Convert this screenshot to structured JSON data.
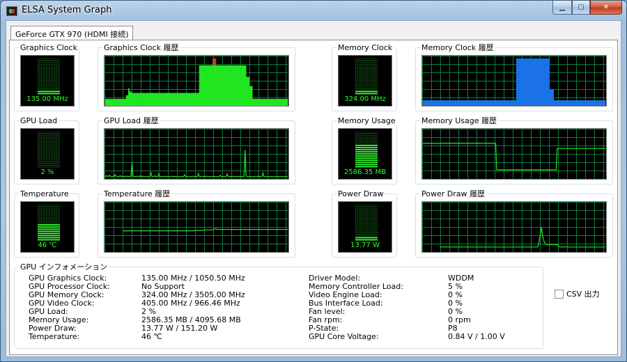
{
  "window": {
    "title": "ELSA System Graph",
    "min_glyph": "▁",
    "max_glyph": "▢",
    "close_glyph": "✕"
  },
  "tabs": [
    {
      "label": "GeForce GTX 970 (HDMI 接続)",
      "selected": true
    }
  ],
  "monitors": {
    "graphics_clock": {
      "label": "Graphics Clock",
      "value": "135.00 MHz",
      "level": 0.1,
      "history_label": "Graphics Clock 履歴",
      "color": "#21e621"
    },
    "memory_clock": {
      "label": "Memory Clock",
      "value": "324.00 MHz",
      "level": 0.1,
      "history_label": "Memory Clock 履歴",
      "color": "#1a73e6"
    },
    "gpu_load": {
      "label": "GPU Load",
      "value": "2 %",
      "level": 0.02,
      "history_label": "GPU Load 履歴",
      "color": "#21e621"
    },
    "memory_usage": {
      "label": "Memory Usage",
      "value": "2586.35 MB",
      "level": 0.63,
      "history_label": "Memory Usage 履歴",
      "color": "#21e621"
    },
    "temperature": {
      "label": "Temperature",
      "value": "46 ℃",
      "level": 0.46,
      "history_label": "Temperature 履歴",
      "color": "#21e621"
    },
    "power_draw": {
      "label": "Power Draw",
      "value": "13.77 W",
      "level": 0.09,
      "history_label": "Power Draw 履歴",
      "color": "#21e621"
    }
  },
  "info": {
    "group_label": "GPU インフォメーション",
    "left": [
      {
        "key": "GPU Graphics Clock:",
        "value": "135.00 MHz / 1050.50 MHz"
      },
      {
        "key": "GPU Processor Clock:",
        "value": "No Support"
      },
      {
        "key": "GPU Memory Clock:",
        "value": "324.00 MHz / 3505.00 MHz"
      },
      {
        "key": "GPU Video Clock:",
        "value": "405.00 MHz / 966.46 MHz"
      },
      {
        "key": "GPU Load:",
        "value": "2 %"
      },
      {
        "key": "Memory Usage:",
        "value": "2586.35 MB / 4095.68 MB"
      },
      {
        "key": "Power Draw:",
        "value": "13.77 W / 151.20 W"
      },
      {
        "key": "Temperature:",
        "value": "46 ℃"
      }
    ],
    "right": [
      {
        "key": "Driver Model:",
        "value": "WDDM"
      },
      {
        "key": "Memory Controller Load:",
        "value": "5 %"
      },
      {
        "key": "Video Engine Load:",
        "value": "0 %"
      },
      {
        "key": "Bus Interface Load:",
        "value": "0 %"
      },
      {
        "key": "Fan level:",
        "value": "0 %"
      },
      {
        "key": "Fan rpm:",
        "value": "0 rpm"
      },
      {
        "key": "P-State:",
        "value": "P8"
      },
      {
        "key": "GPU Core Voltage:",
        "value": "0.84 V / 1.00 V"
      }
    ]
  },
  "csv": {
    "label": "CSV 出力",
    "checked": false
  },
  "chart_data": [
    {
      "id": "graphics_clock_history",
      "type": "area",
      "title": "Graphics Clock 履歴",
      "color": "#21e621",
      "peak_color": "#c03c1c",
      "ylim": [
        0,
        1
      ],
      "values": [
        0.12,
        0.12,
        0.12,
        0.12,
        0.12,
        0.12,
        0.12,
        0.12,
        0.12,
        0.12,
        0.12,
        0.12,
        0.12,
        0.12,
        0.12,
        0.12,
        0.12,
        0.12,
        0.12,
        0.12,
        0.2,
        0.2,
        0.35,
        0.28,
        0.28,
        0.25,
        0.25,
        0.25,
        0.25,
        0.25,
        0.25,
        0.25,
        0.25,
        0.25,
        0.25,
        0.25,
        0.25,
        0.25,
        0.25,
        0.25,
        0.25,
        0.25,
        0.25,
        0.25,
        0.25,
        0.25,
        0.25,
        0.25,
        0.25,
        0.25,
        0.25,
        0.25,
        0.25,
        0.25,
        0.25,
        0.25,
        0.25,
        0.25,
        0.25,
        0.25,
        0.25,
        0.25,
        0.25,
        0.25,
        0.25,
        0.25,
        0.25,
        0.25,
        0.25,
        0.25,
        0.25,
        0.25,
        0.25,
        0.25,
        0.25,
        0.25,
        0.25,
        0.25,
        0.25,
        0.25,
        0.25,
        0.25,
        0.25,
        0.25,
        0.25,
        0.25,
        0.25,
        0.25,
        0.25,
        0.25,
        0.85,
        0.85,
        0.85,
        0.85,
        0.85,
        0.85,
        0.85,
        0.85,
        0.85,
        0.85,
        0.85,
        0.85,
        0.85,
        1.0,
        1.0,
        1.0,
        0.85,
        0.85,
        0.85,
        0.85,
        0.85,
        0.85,
        0.85,
        0.85,
        0.85,
        0.85,
        0.85,
        0.85,
        0.85,
        0.85,
        0.85,
        0.85,
        0.85,
        0.85,
        0.85,
        0.85,
        0.85,
        0.85,
        0.85,
        0.85,
        0.85,
        0.85,
        0.85,
        0.85,
        0.85,
        0.6,
        0.6,
        0.6,
        0.4,
        0.4,
        0.4,
        0.12,
        0.12,
        0.12,
        0.12,
        0.12,
        0.12,
        0.12,
        0.12,
        0.12,
        0.12,
        0.12,
        0.12,
        0.12,
        0.12,
        0.12,
        0.12,
        0.12,
        0.12,
        0.12,
        0.12,
        0.12,
        0.12,
        0.12,
        0.12,
        0.12,
        0.12,
        0.12,
        0.12,
        0.12,
        0.12,
        0.12,
        0.12,
        0.12,
        0.12
      ]
    },
    {
      "id": "memory_clock_history",
      "type": "area",
      "title": "Memory Clock 履歴",
      "color": "#1a73e6",
      "ylim": [
        0,
        1
      ],
      "values": [
        0.09,
        0.09,
        0.09,
        0.09,
        0.09,
        0.09,
        0.09,
        0.09,
        0.09,
        0.09,
        0.09,
        0.09,
        0.09,
        0.09,
        0.09,
        0.09,
        0.09,
        0.09,
        0.09,
        0.09,
        0.09,
        0.09,
        0.09,
        0.09,
        0.09,
        0.09,
        0.09,
        0.09,
        0.09,
        0.09,
        0.09,
        0.09,
        0.09,
        0.09,
        0.09,
        0.09,
        0.09,
        0.09,
        0.09,
        0.09,
        0.09,
        0.09,
        0.09,
        0.09,
        0.09,
        0.09,
        0.09,
        0.09,
        0.09,
        0.09,
        0.09,
        0.09,
        0.09,
        0.09,
        0.09,
        0.09,
        0.09,
        0.09,
        0.09,
        0.09,
        0.09,
        0.09,
        0.09,
        0.09,
        0.09,
        0.09,
        0.09,
        0.09,
        0.09,
        0.09,
        0.09,
        0.09,
        0.09,
        0.09,
        0.09,
        0.09,
        0.09,
        0.09,
        0.09,
        0.09,
        0.09,
        0.09,
        0.09,
        0.09,
        0.09,
        0.09,
        0.09,
        0.09,
        0.09,
        0.09,
        1.0,
        1.0,
        1.0,
        1.0,
        1.0,
        1.0,
        1.0,
        1.0,
        1.0,
        1.0,
        1.0,
        1.0,
        1.0,
        1.0,
        1.0,
        1.0,
        1.0,
        1.0,
        1.0,
        1.0,
        1.0,
        1.0,
        1.0,
        1.0,
        1.0,
        1.0,
        1.0,
        1.0,
        1.0,
        1.0,
        1.0,
        1.0,
        0.32,
        0.32,
        0.32,
        0.32,
        0.09,
        0.09,
        0.09,
        0.09,
        0.09,
        0.09,
        0.09,
        0.09,
        0.09,
        0.09,
        0.09,
        0.09,
        0.09,
        0.09,
        0.09,
        0.09,
        0.09,
        0.09,
        0.09,
        0.09,
        0.09,
        0.09,
        0.09,
        0.09,
        0.09,
        0.09,
        0.09,
        0.09,
        0.09,
        0.09,
        0.09,
        0.09,
        0.09,
        0.09,
        0.09,
        0.09,
        0.09,
        0.09,
        0.09,
        0.09,
        0.09,
        0.09,
        0.09,
        0.09,
        0.09,
        0.09,
        0.09,
        0.09,
        0.09,
        0.09
      ]
    },
    {
      "id": "gpu_load_history",
      "type": "line",
      "title": "GPU Load 履歴",
      "color": "#21e621",
      "ylim": [
        0,
        100
      ],
      "values": [
        2,
        4,
        3,
        2,
        5,
        3,
        2,
        2,
        3,
        2,
        6,
        3,
        2,
        2,
        2,
        4,
        2,
        3,
        2,
        2,
        3,
        2,
        3,
        2,
        2,
        3,
        2,
        32,
        3,
        2,
        2,
        2,
        3,
        2,
        2,
        4,
        2,
        2,
        3,
        2,
        2,
        2,
        2,
        2,
        2,
        3,
        12,
        2,
        2,
        2,
        4,
        2,
        2,
        2,
        8,
        2,
        2,
        2,
        2,
        2,
        3,
        2,
        2,
        2,
        2,
        2,
        2,
        2,
        3,
        2,
        2,
        2,
        2,
        2,
        2,
        2,
        2,
        2,
        2,
        2,
        6,
        2,
        2,
        2,
        2,
        2,
        2,
        2,
        2,
        3,
        2,
        2,
        2,
        2,
        9,
        2,
        2,
        2,
        2,
        2,
        2,
        2,
        3,
        2,
        2,
        2,
        2,
        2,
        2,
        3,
        2,
        2,
        2,
        2,
        2,
        2,
        5,
        2,
        2,
        2,
        2,
        2,
        2,
        8,
        2,
        2,
        2,
        2,
        3,
        2,
        2,
        2,
        2,
        2,
        2,
        2,
        2,
        2,
        2,
        2,
        2,
        60,
        3,
        2,
        2,
        2,
        2,
        2,
        2,
        2,
        2,
        2,
        2,
        2,
        3,
        2,
        2,
        2,
        2,
        10,
        2,
        2,
        2,
        2,
        2,
        2,
        2,
        2,
        2,
        2,
        2,
        2,
        2,
        2,
        2,
        2,
        2,
        2,
        2,
        2,
        2,
        2,
        2,
        2,
        2
      ]
    },
    {
      "id": "memory_usage_history",
      "type": "line",
      "title": "Memory Usage 履歴",
      "color": "#21e621",
      "ylim": [
        0,
        4095.68
      ],
      "values": [
        3050,
        3050,
        3050,
        3050,
        3050,
        3050,
        3050,
        3050,
        3050,
        3050,
        3050,
        3050,
        3050,
        3050,
        3050,
        3050,
        3050,
        3050,
        3050,
        3050,
        3050,
        3050,
        3050,
        3050,
        3050,
        3050,
        3050,
        3050,
        3050,
        3050,
        3050,
        3050,
        3050,
        3050,
        3050,
        3050,
        3050,
        3050,
        3050,
        3050,
        3050,
        3050,
        3050,
        3050,
        3050,
        3050,
        3050,
        3050,
        3050,
        3050,
        3050,
        3050,
        3050,
        3050,
        3050,
        3050,
        3050,
        3050,
        3050,
        3050,
        3050,
        3050,
        3050,
        3050,
        3050,
        3050,
        3050,
        3050,
        3050,
        3050,
        3050,
        3050,
        680,
        680,
        680,
        680,
        680,
        680,
        680,
        680,
        680,
        680,
        680,
        680,
        680,
        680,
        680,
        680,
        680,
        680,
        680,
        680,
        680,
        680,
        680,
        680,
        680,
        680,
        680,
        680,
        680,
        680,
        680,
        680,
        680,
        680,
        680,
        680,
        680,
        680,
        680,
        680,
        680,
        680,
        680,
        680,
        680,
        680,
        680,
        680,
        680,
        680,
        680,
        680,
        680,
        680,
        680,
        680,
        680,
        680,
        680,
        2586.35,
        2586.35,
        2586.35,
        2586.35,
        2586.35,
        2586.35,
        2586.35,
        2586.35,
        2586.35,
        2586.35,
        2586.35,
        2586.35,
        2586.35,
        2586.35,
        2586.35,
        2586.35,
        2586.35,
        2586.35,
        2586.35,
        2586.35,
        2586.35,
        2586.35,
        2586.35,
        2586.35,
        2586.35,
        2586.35,
        2586.35,
        2586.35,
        2586.35,
        2586.35,
        2586.35,
        2586.35,
        2586.35,
        2586.35,
        2586.35,
        2586.35,
        2586.35,
        2586.35,
        2586.35,
        2586.35,
        2586.35,
        2586.35,
        2586.35,
        2586.35,
        2586.35,
        2586.35,
        2586.35,
        2586.35
      ]
    },
    {
      "id": "temperature_history",
      "type": "line",
      "title": "Temperature 履歴",
      "color": "#21e621",
      "ylim": [
        0,
        100
      ],
      "values": [
        null,
        null,
        null,
        null,
        null,
        null,
        null,
        null,
        null,
        null,
        null,
        null,
        null,
        null,
        null,
        null,
        null,
        null,
        43,
        43,
        43,
        43,
        43,
        43,
        43,
        43,
        43,
        43,
        43,
        43,
        43,
        43,
        43,
        43,
        43,
        43,
        43,
        43,
        43,
        43,
        43,
        43,
        43,
        43,
        43,
        43,
        43,
        43,
        43,
        43,
        43,
        43,
        43,
        43,
        43,
        43,
        43,
        43,
        43,
        43,
        43,
        43,
        43,
        43,
        43,
        43,
        43,
        43,
        43,
        43,
        43,
        43,
        43,
        43,
        43,
        43,
        43,
        43,
        43,
        43,
        43,
        43,
        43,
        43,
        43,
        43,
        43,
        43,
        43,
        43,
        44,
        44,
        44,
        44,
        44,
        44,
        44,
        44,
        44,
        45,
        45,
        45,
        45,
        45,
        45,
        45,
        45,
        45,
        46,
        46,
        47,
        48,
        46,
        46,
        47,
        46,
        46,
        46,
        46,
        46,
        46,
        46,
        46,
        46,
        46,
        46,
        46,
        46,
        46,
        46,
        46,
        46,
        46,
        46,
        46,
        46,
        46,
        46,
        46,
        46,
        46,
        46,
        46,
        46,
        46,
        46,
        46,
        46,
        46,
        46,
        46,
        46,
        46,
        46,
        46,
        46,
        46,
        46,
        46,
        46,
        46,
        46,
        46,
        46,
        46,
        46,
        46,
        46,
        46,
        46,
        46,
        46,
        46,
        46,
        46,
        46,
        46,
        46,
        46,
        46,
        46,
        46,
        46,
        46
      ]
    },
    {
      "id": "power_draw_history",
      "type": "line",
      "title": "Power Draw 履歴",
      "color": "#21e621",
      "ylim": [
        0,
        151.2
      ],
      "values": [
        null,
        null,
        null,
        null,
        null,
        null,
        null,
        null,
        null,
        null,
        null,
        null,
        null,
        null,
        null,
        null,
        null,
        null,
        12,
        12,
        12,
        12,
        12,
        12,
        12,
        13,
        12,
        12,
        12,
        12,
        12,
        12,
        12,
        12,
        12,
        13,
        12,
        12,
        12,
        12,
        12,
        12,
        12,
        12,
        12,
        12,
        12,
        12,
        13,
        12,
        12,
        12,
        12,
        12,
        12,
        12,
        12,
        12,
        12,
        12,
        12,
        12,
        12,
        12,
        12,
        12,
        12,
        12,
        12,
        12,
        12,
        12,
        12,
        12,
        12,
        12,
        12,
        12,
        12,
        12,
        12,
        12,
        12,
        12,
        12,
        12,
        12,
        12,
        12,
        12,
        12,
        12,
        12,
        12,
        12,
        12,
        12,
        12,
        12,
        12,
        12,
        12,
        12,
        12,
        12,
        12,
        12,
        12,
        12,
        12,
        12,
        12,
        12,
        12,
        12,
        12,
        12,
        12,
        12,
        12,
        12,
        12,
        12,
        20,
        40,
        56,
        78,
        52,
        40,
        28,
        22,
        20,
        20,
        20,
        20,
        20,
        20,
        20,
        20,
        20,
        20,
        20,
        20,
        20,
        14,
        12,
        12,
        12,
        12,
        12,
        12,
        12,
        12,
        13,
        12,
        12,
        12,
        12,
        12,
        12,
        12,
        12,
        12,
        12,
        12,
        12,
        12,
        12,
        12,
        12,
        12,
        12,
        12,
        12,
        12,
        12,
        12,
        12,
        12,
        12,
        12,
        12,
        12,
        12,
        12,
        12,
        12,
        12,
        12,
        12,
        12,
        12,
        12,
        12,
        12
      ]
    }
  ]
}
